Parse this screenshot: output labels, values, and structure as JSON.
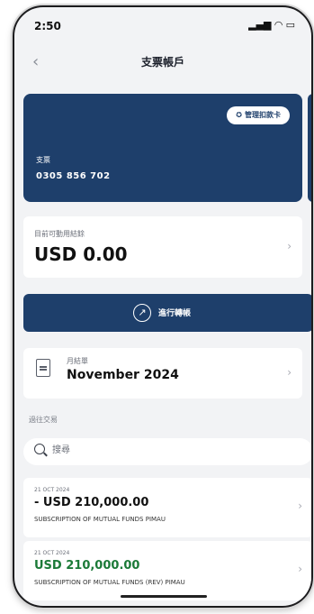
{
  "status_bar": {
    "time": "2:50",
    "icons": "▂▄▆ ◠ ▭"
  },
  "header": {
    "back_icon": "chevron-left-icon",
    "title": "支票帳戶"
  },
  "account_card": {
    "manage_label": "管理扣款卡",
    "type": "支票",
    "number": "0305 856 702"
  },
  "balance": {
    "label": "目前可動用結餘",
    "amount": "USD 0.00"
  },
  "transfer": {
    "label": "進行轉帳"
  },
  "statement": {
    "label": "月結單",
    "month": "November 2024"
  },
  "transactions_section": {
    "label": "過往交易",
    "search_placeholder": "搜尋",
    "items": [
      {
        "date": "21 OCT 2024",
        "amount": "- USD 210,000.00",
        "description": "SUBSCRIPTION OF MUTUAL FUNDS PIMAU",
        "positive": false
      },
      {
        "date": "21 OCT 2024",
        "amount": "USD 210,000.00",
        "description": "SUBSCRIPTION OF MUTUAL FUNDS (REV) PIMAU",
        "positive": true
      }
    ]
  },
  "colors": {
    "accent": "#1e3f6b",
    "positive_amount": "#1c7a38"
  }
}
